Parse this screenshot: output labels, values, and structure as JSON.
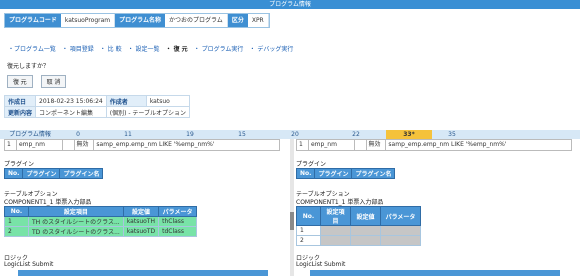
{
  "window": {
    "title": "プログラム情報"
  },
  "info": {
    "program_code_label": "プログラムコード",
    "program_code_value": "katsuoProgram",
    "program_name_label": "プログラム名称",
    "program_name_value": "かつおのプログラム",
    "kubun_label": "区分",
    "kubun_value": "XPR"
  },
  "links": {
    "program_list": "・プログラム一覧",
    "item_register": "・ 項目登録",
    "compare": "・ 比 較",
    "settings_list": "・ 設定一覧",
    "revert": "・ 復 元",
    "run_program": "・ プログラム実行",
    "debug_run": "・ デバッグ実行"
  },
  "question": "復元しますか？",
  "buttons": {
    "restore": "復 元",
    "cancel": "取 消"
  },
  "meta": {
    "created_label": "作成日",
    "created_value": "2018-02-23 15:06:24",
    "author_label": "作成者",
    "author_value": "katsuo",
    "update_label": "更新内容",
    "update_value": "コンポーネント編集",
    "update_extra": "(個別) ‐ テーブルオプション"
  },
  "tabs": {
    "header": "プログラム情報",
    "items": [
      "0",
      "11",
      "19",
      "15",
      "20",
      "22",
      "33*",
      "35"
    ],
    "active_index": 6
  },
  "left": {
    "row": {
      "no": "1",
      "name": "emp_nm",
      "flag": "",
      "status": "無効",
      "expr": "samp_emp.emp_nm LIKE '%emp_nm%'"
    },
    "plugin_title": "プラグイン",
    "plugin_cols": [
      "No.",
      "プラグイン",
      "プラグイン名"
    ],
    "option_title": "テーブルオプション",
    "component_name": "COMPONENT1_1 単票入力部品",
    "option_cols": [
      "No.",
      "設定項目",
      "設定値",
      "パラメータ"
    ],
    "option_rows": [
      [
        "1",
        "TH のスタイルシートのクラス...",
        "katsuoTH",
        "thClass"
      ],
      [
        "2",
        "TD のスタイルシートのクラス...",
        "katsuoTD",
        "tdClass"
      ]
    ],
    "logic_title": "ロジック",
    "logic_sub": "LogicList Submit"
  },
  "right": {
    "row": {
      "no": "1",
      "name": "emp_nm",
      "flag": "",
      "status": "無効",
      "expr": "samp_emp.emp_nm LIKE '%emp_nm%'"
    },
    "plugin_title": "プラグイン",
    "plugin_cols": [
      "No.",
      "プラグイン",
      "プラグイン名"
    ],
    "option_title": "テーブルオプション",
    "component_name": "COMPONENT1_1 単票入力部品",
    "option_cols": [
      "No.",
      "設定項目",
      "設定値",
      "パラメータ"
    ],
    "option_rows": [
      [
        "1",
        "",
        "",
        ""
      ],
      [
        "2",
        "",
        "",
        ""
      ]
    ],
    "logic_title": "ロジック",
    "logic_sub": "LogicList Submit"
  }
}
